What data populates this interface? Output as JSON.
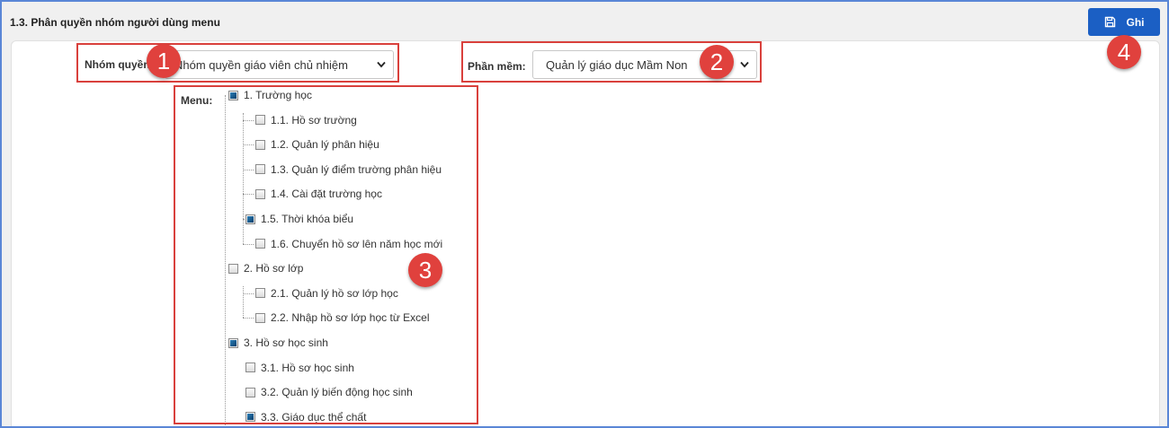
{
  "page": {
    "title": "1.3. Phân quyền nhóm người dùng menu"
  },
  "toolbar": {
    "save_label": "Ghi"
  },
  "filters": {
    "group_label": "Nhóm quyền:",
    "group_value": "Nhóm quyền giáo viên chủ nhiệm",
    "software_label": "Phần mềm:",
    "software_value": "Quản lý giáo dục Mầm Non"
  },
  "menu": {
    "label": "Menu:",
    "groups": [
      {
        "label": "1. Trường học",
        "state": "partial",
        "children": [
          {
            "label": "1.1. Hồ sơ trường",
            "state": "unchecked"
          },
          {
            "label": "1.2. Quản lý phân hiệu",
            "state": "unchecked"
          },
          {
            "label": "1.3. Quản lý điểm trường phân hiệu",
            "state": "unchecked"
          },
          {
            "label": "1.4. Cài đặt trường học",
            "state": "unchecked"
          },
          {
            "label": "1.5. Thời khóa biểu",
            "state": "partial"
          },
          {
            "label": "1.6. Chuyển hồ sơ lên năm học mới",
            "state": "unchecked"
          }
        ]
      },
      {
        "label": "2. Hồ sơ lớp",
        "state": "unchecked",
        "children": [
          {
            "label": "2.1. Quản lý hồ sơ lớp học",
            "state": "unchecked"
          },
          {
            "label": "2.2. Nhập hồ sơ lớp học từ Excel",
            "state": "unchecked"
          }
        ]
      },
      {
        "label": "3. Hồ sơ học sinh",
        "state": "partial",
        "children": [
          {
            "label": "3.1. Hồ sơ học sinh",
            "state": "unchecked"
          },
          {
            "label": "3.2. Quản lý biến động học sinh",
            "state": "unchecked"
          },
          {
            "label": "3.3. Giáo dục thể chất",
            "state": "partial"
          }
        ]
      }
    ]
  },
  "callouts": [
    "1",
    "2",
    "3",
    "4"
  ],
  "colors": {
    "accent": "#1b5fc4",
    "callout": "#e0413d",
    "frame": "#5a86d6"
  }
}
